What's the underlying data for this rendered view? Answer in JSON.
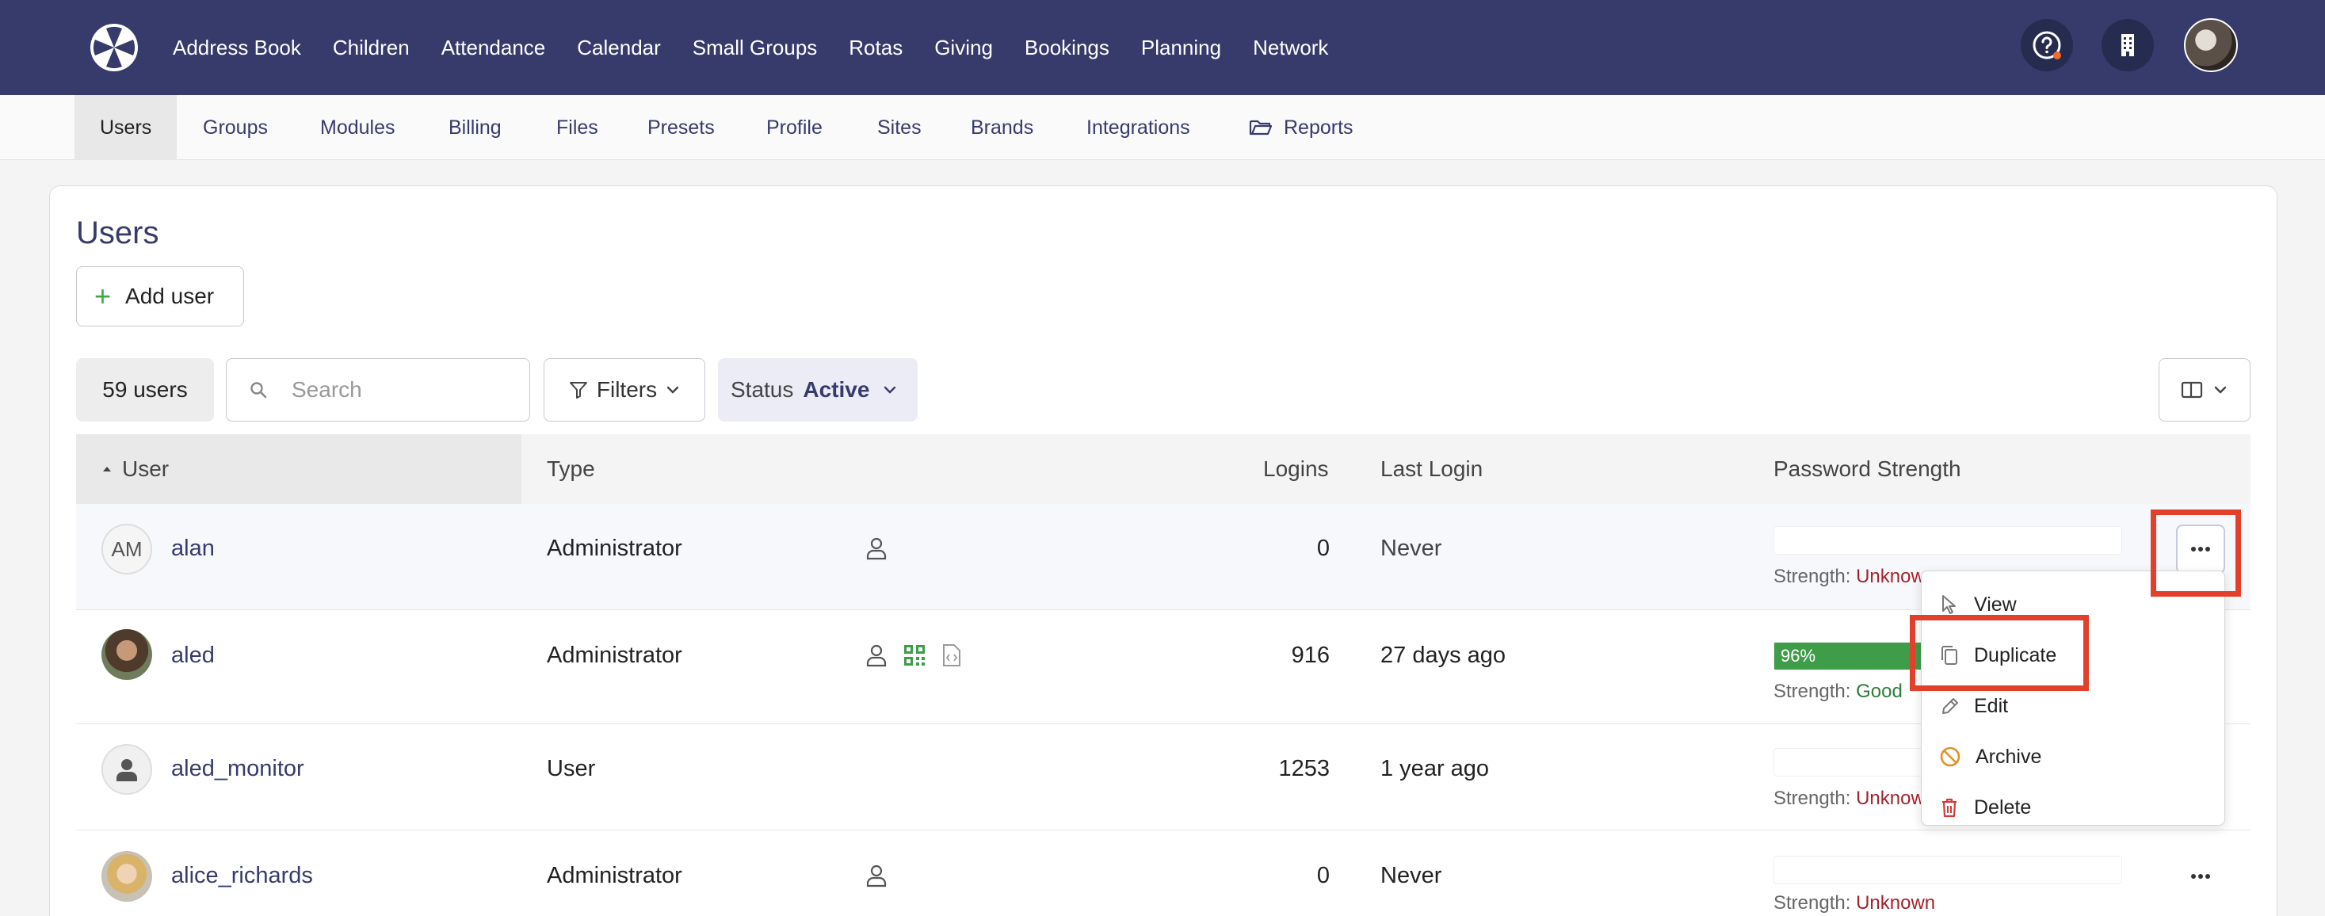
{
  "nav": {
    "items": [
      "Address Book",
      "Children",
      "Attendance",
      "Calendar",
      "Small Groups",
      "Rotas",
      "Giving",
      "Bookings",
      "Planning",
      "Network"
    ]
  },
  "subnav": {
    "tabs": [
      "Users",
      "Groups",
      "Modules",
      "Billing",
      "Files",
      "Presets",
      "Profile",
      "Sites",
      "Brands",
      "Integrations",
      "Reports"
    ]
  },
  "page": {
    "title": "Users",
    "add_user_label": "Add user"
  },
  "toolbar": {
    "count": "59 users",
    "search_placeholder": "Search",
    "filters_label": "Filters",
    "status_label": "Status",
    "status_value": "Active"
  },
  "table": {
    "headers": [
      "User",
      "Type",
      "Logins",
      "Last Login",
      "Password Strength"
    ],
    "strength_prefix": "Strength:",
    "rows": [
      {
        "initials": "AM",
        "user": "alan",
        "type": "Administrator",
        "logins": "0",
        "last_login": "Never",
        "strength_percent": "",
        "strength_value": 0,
        "strength": "Unknown"
      },
      {
        "initials": "",
        "user": "aled",
        "type": "Administrator",
        "logins": "916",
        "last_login": "27 days ago",
        "strength_percent": "96%",
        "strength_value": 0.96,
        "strength": "Good"
      },
      {
        "initials": "",
        "user": "aled_monitor",
        "type": "User",
        "logins": "1253",
        "last_login": "1 year ago",
        "strength_percent": "",
        "strength_value": 0,
        "strength": "Unknown"
      },
      {
        "initials": "",
        "user": "alice_richards",
        "type": "Administrator",
        "logins": "0",
        "last_login": "Never",
        "strength_percent": "",
        "strength_value": 0,
        "strength": "Unknown"
      }
    ]
  },
  "context_menu": {
    "items": [
      "View",
      "Duplicate",
      "Edit",
      "Archive",
      "Delete"
    ]
  },
  "colors": {
    "navbar": "#363b6c",
    "accent": "#363b6c",
    "success": "#3f9d4a",
    "danger": "#a3232c",
    "highlight": "#e2402b"
  }
}
